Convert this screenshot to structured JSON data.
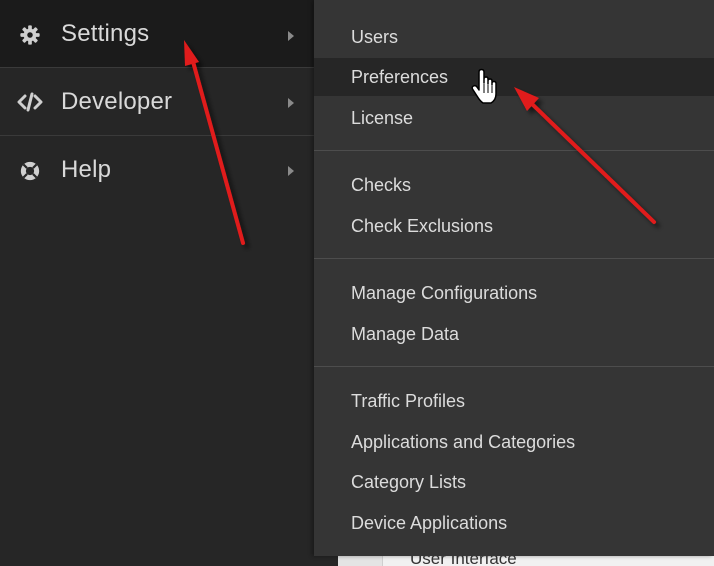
{
  "sidebar": {
    "items": [
      {
        "label": "Settings",
        "icon": "gear-icon",
        "active": true
      },
      {
        "label": "Developer",
        "icon": "code-icon",
        "active": false
      },
      {
        "label": "Help",
        "icon": "lifebuoy-icon",
        "active": false
      }
    ]
  },
  "submenu": {
    "items": [
      {
        "label": "Users"
      },
      {
        "label": "Preferences",
        "hovered": true
      },
      {
        "label": "License"
      },
      {
        "label": "Checks"
      },
      {
        "label": "Check Exclusions"
      },
      {
        "label": "Manage Configurations"
      },
      {
        "label": "Manage Data"
      },
      {
        "label": "Traffic Profiles"
      },
      {
        "label": "Applications and Categories"
      },
      {
        "label": "Category Lists"
      },
      {
        "label": "Device Applications"
      }
    ]
  },
  "underlay": {
    "partial_text": "User Interface"
  },
  "colors": {
    "sidebar_bg": "#262626",
    "submenu_bg": "#353535",
    "accent": "#2f8f7c",
    "annotation_arrow": "#e01a1a"
  }
}
